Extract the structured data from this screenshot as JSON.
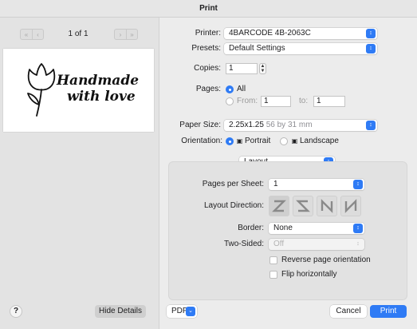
{
  "window": {
    "title": "Print"
  },
  "preview": {
    "page_indicator": "1 of 1",
    "label_text_line1": "Handmade",
    "label_text_line2": "with love",
    "help_label": "?",
    "hide_details_label": "Hide Details"
  },
  "settings": {
    "printer": {
      "label": "Printer:",
      "value": "4BARCODE 4B-2063C"
    },
    "presets": {
      "label": "Presets:",
      "value": "Default Settings"
    },
    "copies": {
      "label": "Copies:",
      "value": "1"
    },
    "pages": {
      "label": "Pages:",
      "all_label": "All",
      "from_label": "From:",
      "from_value": "1",
      "to_label": "to:",
      "to_value": "1"
    },
    "paper_size": {
      "label": "Paper Size:",
      "value": "2.25x1.25",
      "detail": "56 by 31 mm"
    },
    "orientation": {
      "label": "Orientation:",
      "portrait_label": "Portrait",
      "landscape_label": "Landscape"
    },
    "section": {
      "value": "Layout"
    }
  },
  "layout": {
    "pages_per_sheet": {
      "label": "Pages per Sheet:",
      "value": "1"
    },
    "layout_direction": {
      "label": "Layout Direction:"
    },
    "border": {
      "label": "Border:",
      "value": "None"
    },
    "two_sided": {
      "label": "Two-Sided:",
      "value": "Off"
    },
    "reverse_label": "Reverse page orientation",
    "flip_label": "Flip horizontally"
  },
  "footer": {
    "pdf_label": "PDF",
    "cancel_label": "Cancel",
    "print_label": "Print"
  },
  "colors": {
    "accent": "#2f7bf5"
  }
}
